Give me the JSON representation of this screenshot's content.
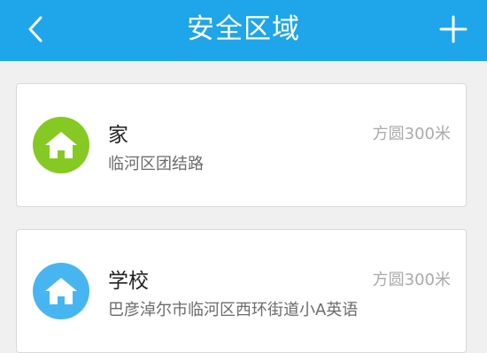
{
  "header": {
    "title": "安全区域",
    "background_color": "#1ea5ea",
    "back_icon": "chevron-left-icon",
    "add_icon": "plus-icon"
  },
  "zones": [
    {
      "name": "家",
      "address": "临河区团结路",
      "radius": "方圆300米",
      "icon": "home-icon",
      "icon_color": "#86c923"
    },
    {
      "name": "学校",
      "address": "巴彦淖尔市临河区西环街道小A英语",
      "radius": "方圆300米",
      "icon": "home-icon",
      "icon_color": "#47b6f0"
    }
  ]
}
